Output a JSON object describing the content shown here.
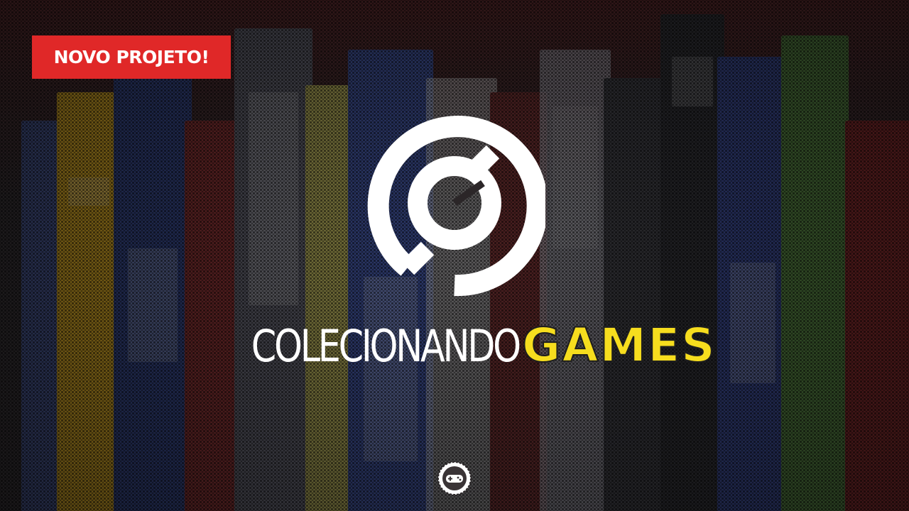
{
  "badge": {
    "label": "NOVO PROJETO!",
    "color": "#e02828"
  },
  "brand": {
    "name_main": "COLECIONANDO",
    "name_accent": "GAMES",
    "accent_color": "#f6dd1e",
    "logo_icon": "g-circle-logo-icon",
    "bottom_icon": "gamepad-seal-icon"
  },
  "background": {
    "description_icon": "game-boxes-shelf-background"
  }
}
